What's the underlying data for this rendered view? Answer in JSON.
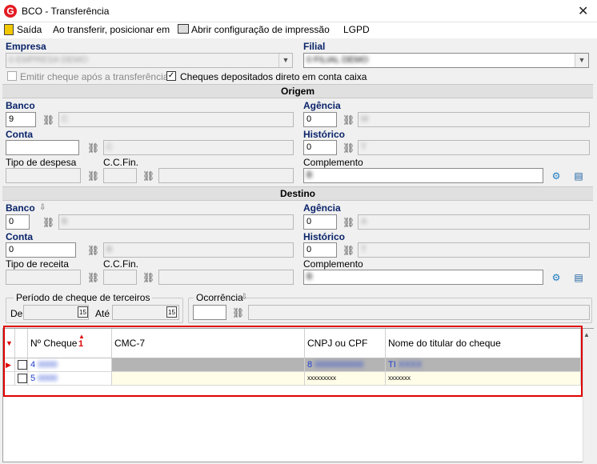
{
  "window": {
    "title": "BCO - Transferência",
    "close": "✕"
  },
  "menu": {
    "exit": "Saída",
    "position": "Ao transferir, posicionar em",
    "print": "Abrir configuração de impressão",
    "lgpd": "LGPD"
  },
  "header": {
    "empresa_label": "Empresa",
    "empresa_value": "0 EMPRESA DEMO",
    "filial_label": "Filial",
    "filial_value": "0 FILIAL DEMO",
    "emitir_label": "Emitir cheque após a transferência",
    "depositados_label": "Cheques depositados direto em conta caixa"
  },
  "origem": {
    "title": "Origem",
    "banco_label": "Banco",
    "banco_code": "9",
    "banco_name": "C",
    "agencia_label": "Agência",
    "agencia_code": "0",
    "agencia_name": "M",
    "conta_label": "Conta",
    "conta_code": "",
    "conta_name": "C",
    "historico_label": "Histórico",
    "historico_code": "0",
    "historico_name": "T",
    "tipo_label": "Tipo de despesa",
    "ccfin_label": "C.C.Fin.",
    "complemento_label": "Complemento",
    "complemento_value": "B"
  },
  "destino": {
    "title": "Destino",
    "banco_label": "Banco",
    "banco_code": "0",
    "banco_name": "B",
    "agencia_label": "Agência",
    "agencia_code": "0",
    "agencia_name": "A",
    "conta_label": "Conta",
    "conta_code": "0",
    "conta_name": "B",
    "historico_label": "Histórico",
    "historico_code": "0",
    "historico_name": "T",
    "tipo_label": "Tipo de receita",
    "ccfin_label": "C.C.Fin.",
    "complemento_label": "Complemento",
    "complemento_value": "B"
  },
  "periodo": {
    "label": "Período de cheque de terceiros",
    "de_label": "De",
    "ate_label": "Até",
    "cal": "15"
  },
  "ocorrencia": {
    "label": "Ocorrência"
  },
  "grid": {
    "columns": [
      "Nº Cheque",
      "CMC-7",
      "CNPJ ou CPF",
      "Nome do titular do cheque"
    ],
    "sort_index": "1",
    "rows": [
      {
        "cheque": "4",
        "cmc7": "",
        "cnpj": "8",
        "nome": "TI"
      },
      {
        "cheque": "5",
        "cmc7": "",
        "cnpj": "xxxxxxxxx",
        "nome": "xxxxxxx"
      }
    ]
  }
}
